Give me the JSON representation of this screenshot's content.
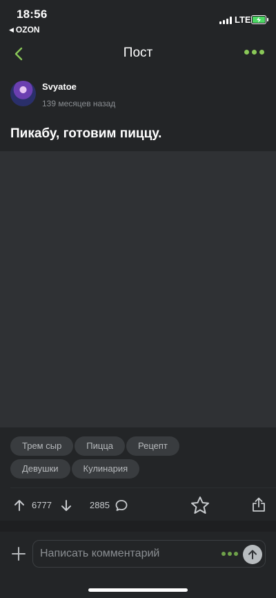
{
  "status_bar": {
    "time": "18:56",
    "back_app": "OZON",
    "network": "LTE",
    "battery_color": "#4cd964"
  },
  "nav": {
    "title": "Пост",
    "back_icon": "chevron-left-icon",
    "more_icon": "more-dots-icon",
    "accent": "#8ac858"
  },
  "post": {
    "author": "Svyatoe",
    "time_ago": "139 месяцев назад",
    "title": "Пикабу, готовим пиццу.",
    "tags": [
      "Трем сыр",
      "Пицца",
      "Рецепт",
      "Девушки",
      "Кулинария"
    ]
  },
  "actions": {
    "rating": "6777",
    "comments": "2885",
    "icons": [
      "arrow-up-icon",
      "arrow-down-icon",
      "comment-icon",
      "star-icon",
      "share-icon"
    ]
  },
  "composer": {
    "placeholder": "Написать комментарий"
  }
}
